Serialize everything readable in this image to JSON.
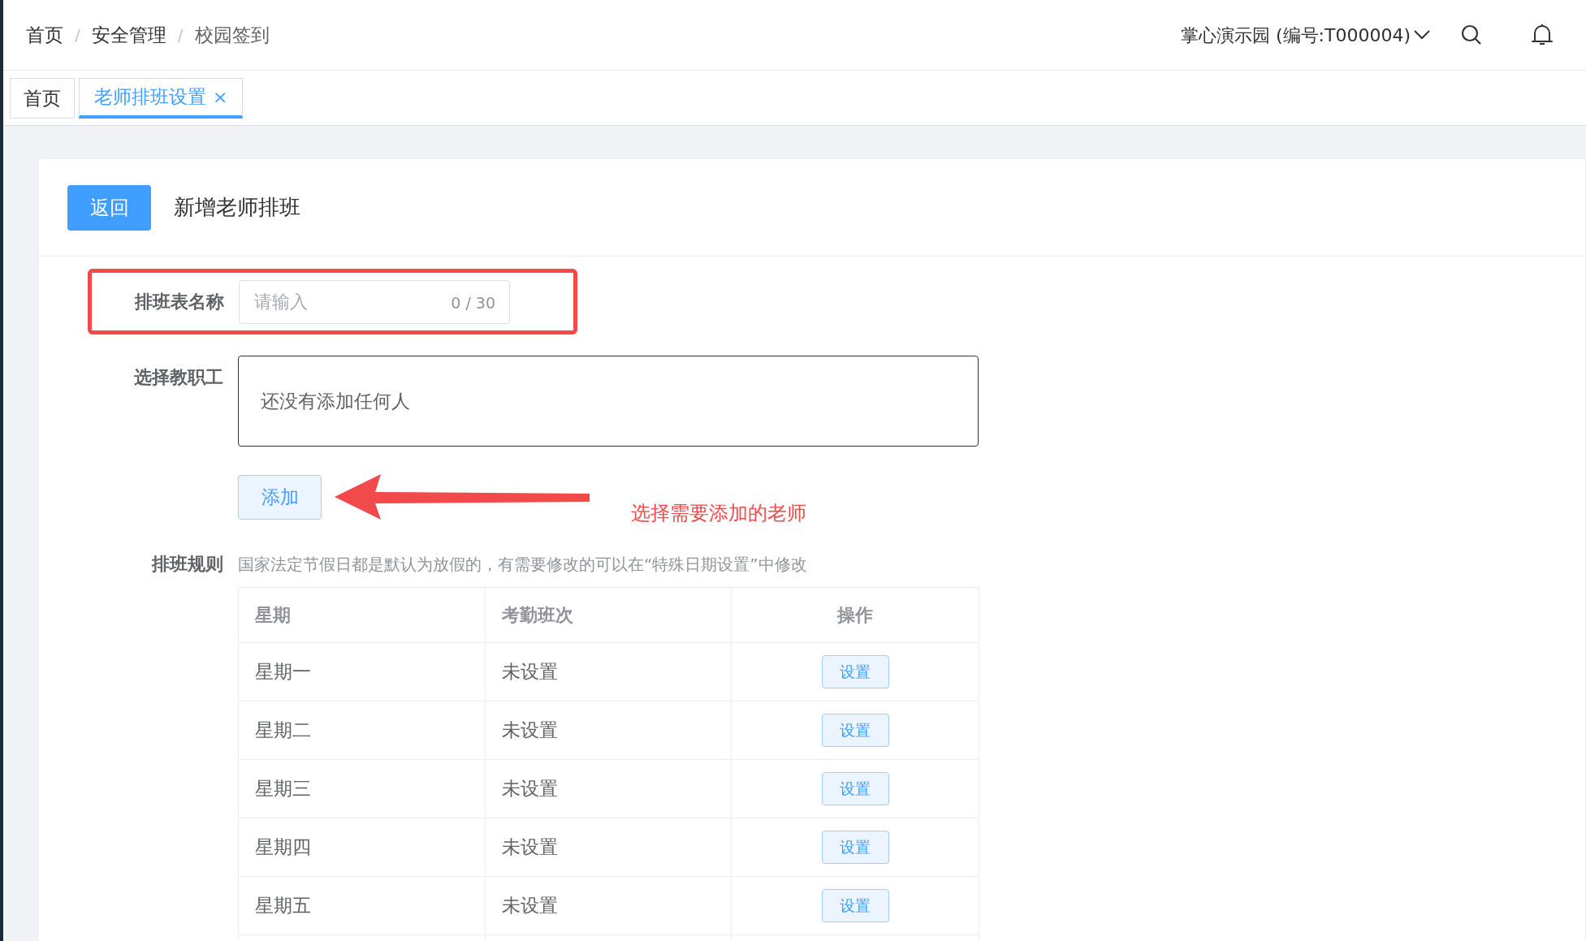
{
  "breadcrumb": [
    "首页",
    "安全管理",
    "校园签到"
  ],
  "breadcrumb_separator": "/",
  "school": "掌心演示园 (编号:T000004)",
  "tabs": [
    {
      "label": "首页",
      "selected": false,
      "closable": false
    },
    {
      "label": "老师排班设置",
      "selected": true,
      "closable": true
    }
  ],
  "tab_close": "×",
  "page": {
    "back_button": "返回",
    "title": "新增老师排班"
  },
  "form": {
    "name_label": "排班表名称",
    "name_placeholder": "请输入",
    "name_counter": "0 / 30",
    "staff_label": "选择教职工",
    "staff_empty": "还没有添加任何人",
    "add_button": "添加",
    "rules_label": "排班规则",
    "rules_hint": "国家法定节假日都是默认为放假的，有需要修改的可以在“特殊日期设置”中修改"
  },
  "annotation": {
    "text": "选择需要添加的老师"
  },
  "table": {
    "columns": [
      "星期",
      "考勤班次",
      "操作"
    ],
    "rows": [
      {
        "day": "星期一",
        "shift": "未设置",
        "action": "设置"
      },
      {
        "day": "星期二",
        "shift": "未设置",
        "action": "设置"
      },
      {
        "day": "星期三",
        "shift": "未设置",
        "action": "设置"
      },
      {
        "day": "星期四",
        "shift": "未设置",
        "action": "设置"
      },
      {
        "day": "星期五",
        "shift": "未设置",
        "action": "设置"
      }
    ]
  }
}
